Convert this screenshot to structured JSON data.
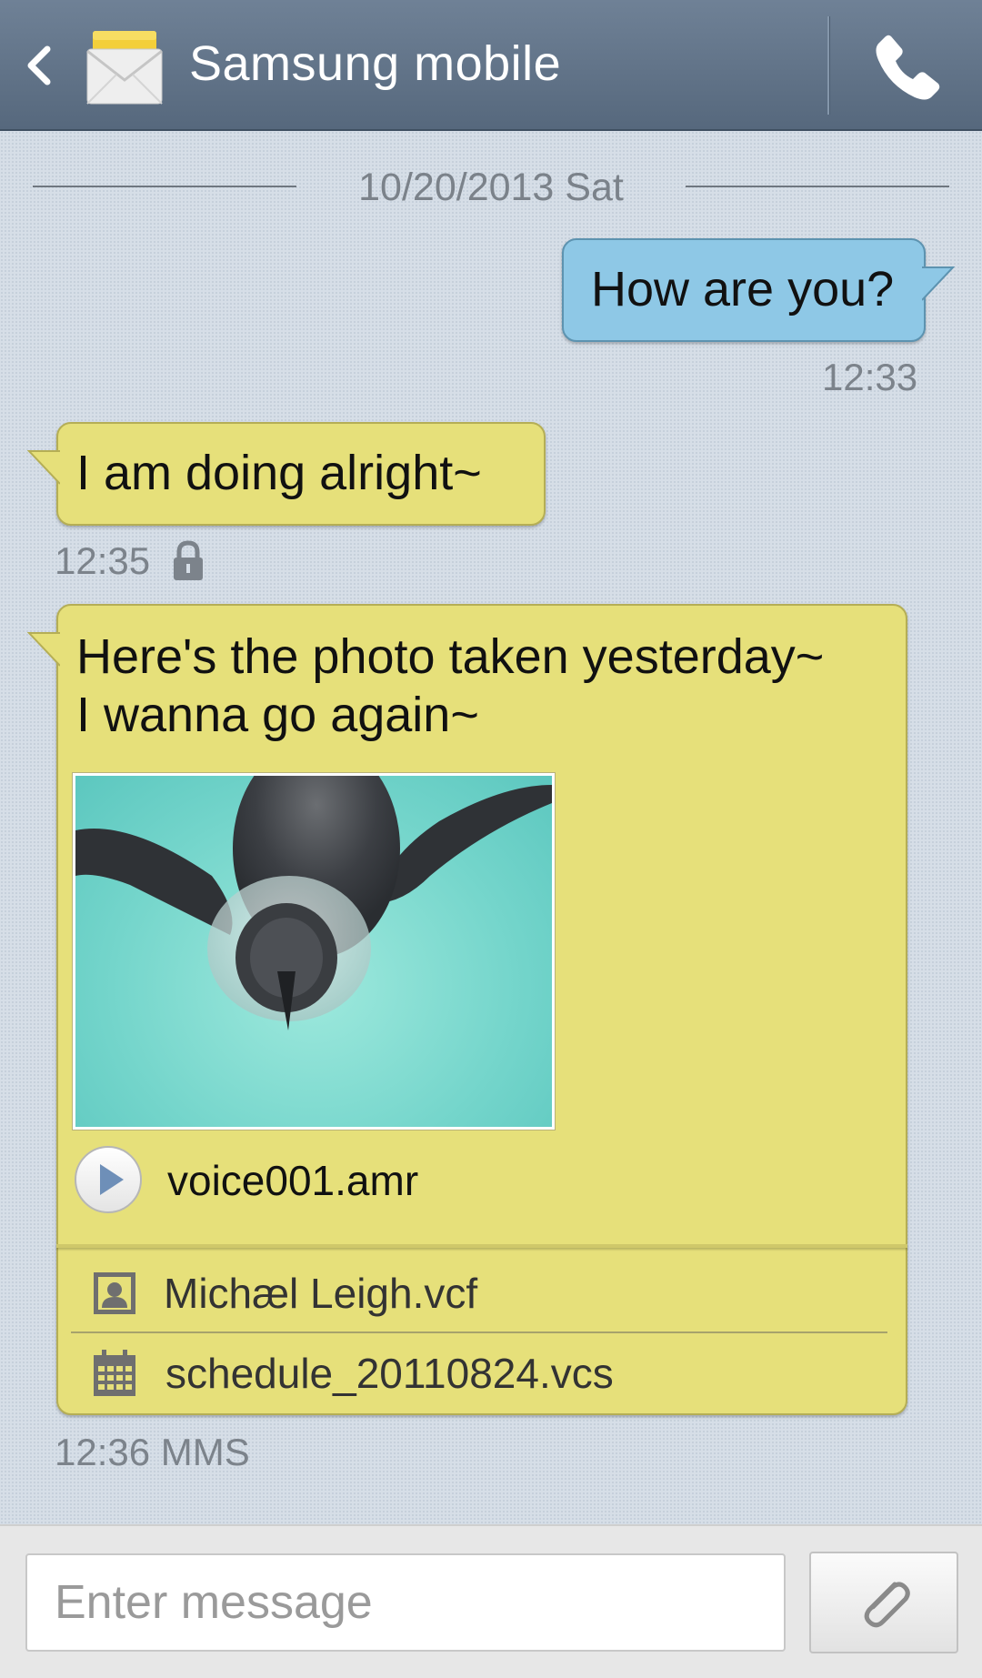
{
  "header": {
    "title": "Samsung mobile",
    "back_icon": "back-chevron-icon",
    "app_icon": "envelope-icon",
    "call_icon": "phone-icon"
  },
  "conversation": {
    "date_divider": "10/20/2013 Sat",
    "messages": [
      {
        "direction": "outgoing",
        "text": "How are you?",
        "time": "12:33"
      },
      {
        "direction": "incoming",
        "text": "I am doing alright~",
        "time": "12:35",
        "lock_icon": "lock-icon"
      },
      {
        "direction": "incoming",
        "text_line1": "Here's the photo taken yesterday~",
        "text_line2": "I wanna go again~",
        "image": "penguin-photo",
        "audio": "voice001.amr",
        "attachments": [
          {
            "icon": "contact-card-icon",
            "name": "Michæl Leigh.vcf"
          },
          {
            "icon": "calendar-icon",
            "name": "schedule_20110824.vcs"
          }
        ],
        "time": "12:36",
        "type_label": "MMS"
      }
    ]
  },
  "composer": {
    "placeholder": "Enter message",
    "attach_icon": "paperclip-icon"
  },
  "colors": {
    "header": "#5e7085",
    "outgoing_bubble": "#8ec8e6",
    "incoming_bubble": "#e6e07a",
    "background": "#d6dee7"
  }
}
